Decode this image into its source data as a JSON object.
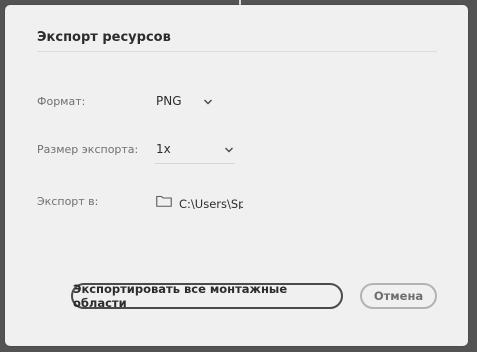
{
  "dialog": {
    "title": "Экспорт ресурсов",
    "format": {
      "label": "Формат:",
      "value": "PNG",
      "icon": "chevron-down-icon"
    },
    "export_size": {
      "label": "Размер экспорта:",
      "value": "1x",
      "icon": "chevron-down-icon"
    },
    "export_to": {
      "label": "Экспорт в:",
      "path": "C:\\Users\\Spa",
      "icon": "folder-icon"
    },
    "buttons": {
      "export_all": "Экспортировать все монтажные области",
      "cancel": "Отмена"
    }
  },
  "colors": {
    "dialog_bg": "#f0f0f0",
    "backdrop": "#535353",
    "text_primary": "#2c2c2c",
    "text_label": "#707070"
  }
}
